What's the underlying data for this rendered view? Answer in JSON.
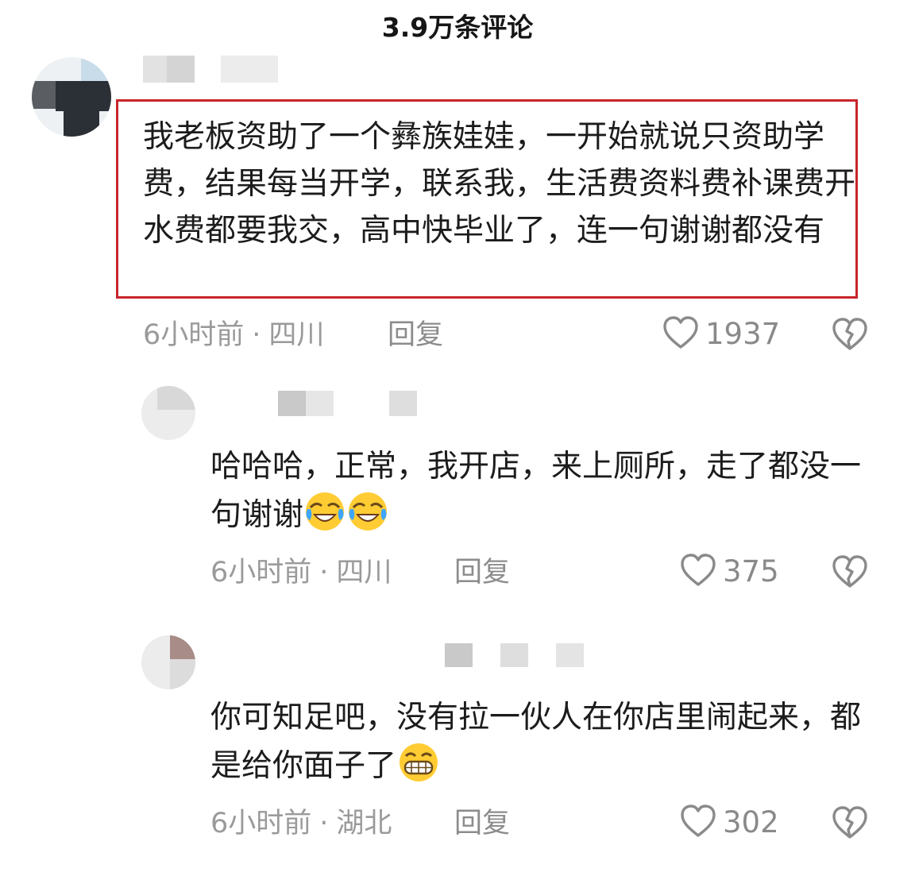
{
  "header": {
    "title": "3.9万条评论"
  },
  "comments": [
    {
      "text": "我老板资助了一个彝族娃娃，一开始就说只资助学费，结果每当开学，联系我，生活费资料费补课费开水费都要我交，高中快毕业了，连一句谢谢都没有",
      "time": "6小时前",
      "separator": "·",
      "location": "四川",
      "reply_label": "回复",
      "likes": "1937",
      "highlighted": true
    },
    {
      "text": "哈哈哈，正常，我开店，来上厕所，走了都没一句谢谢",
      "emojis": [
        "laugh-cry-emoji",
        "laugh-cry-emoji"
      ],
      "time": "6小时前",
      "separator": "·",
      "location": "四川",
      "reply_label": "回复",
      "likes": "375"
    },
    {
      "text": "你可知足吧，没有拉一伙人在你店里闹起来，都是给你面子了",
      "emojis": [
        "grin-emoji"
      ],
      "time": "6小时前",
      "separator": "·",
      "location": "湖北",
      "reply_label": "回复",
      "likes": "302"
    }
  ],
  "icons": {
    "like": "heart-outline-icon",
    "dislike": "broken-heart-icon"
  },
  "colors": {
    "highlight_border": "#c8252b",
    "meta_text": "#9a9a9a",
    "icon_stroke": "#8a8a8a"
  }
}
